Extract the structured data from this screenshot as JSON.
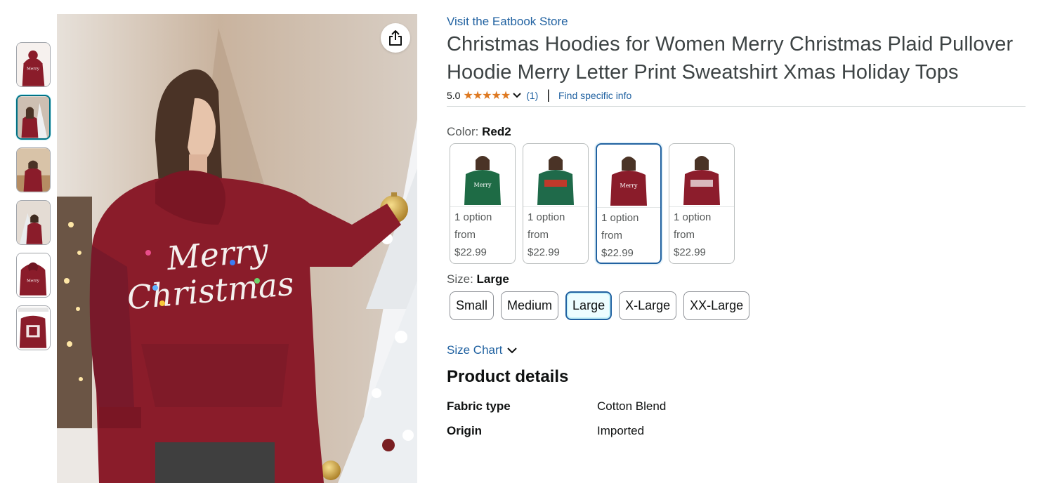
{
  "store_link": "Visit the Eatbook Store",
  "title": "Christmas Hoodies for Women Merry Christmas Plaid Pullover Hoodie Merry Letter Print Sweatshirt Xmas Holiday Tops",
  "rating": {
    "value": "5.0",
    "stars": 5,
    "count": "(1)",
    "find_info": "Find specific info"
  },
  "color": {
    "label": "Color:",
    "selected": "Red2",
    "options": [
      {
        "name": "green-plaid-hoodie",
        "line1": "1 option",
        "line2": "from",
        "price": "$22.99",
        "color": "#1e6b45"
      },
      {
        "name": "green-red-plaid-hoodie",
        "line1": "1 option",
        "line2": "from",
        "price": "$22.99",
        "color": "#1f6a4a"
      },
      {
        "name": "red2-hoodie",
        "line1": "1 option",
        "line2": "from",
        "price": "$22.99",
        "color": "#8a1c2a"
      },
      {
        "name": "red-plaid-hoodie",
        "line1": "1 option",
        "line2": "from",
        "price": "$22.99",
        "color": "#8c1d2c"
      }
    ]
  },
  "size": {
    "label": "Size:",
    "selected": "Large",
    "options": [
      "Small",
      "Medium",
      "Large",
      "X-Large",
      "XX-Large"
    ]
  },
  "size_chart": "Size Chart",
  "product_details": {
    "title": "Product details",
    "rows": [
      {
        "key": "Fabric type",
        "value": "Cotton Blend"
      },
      {
        "key": "Origin",
        "value": "Imported"
      }
    ]
  },
  "main_image": {
    "print_line1": "Merry",
    "print_line2": "Christmas"
  },
  "colors": {
    "link": "#2162a1",
    "star": "#de7921",
    "selected_border": "#2162a1"
  }
}
